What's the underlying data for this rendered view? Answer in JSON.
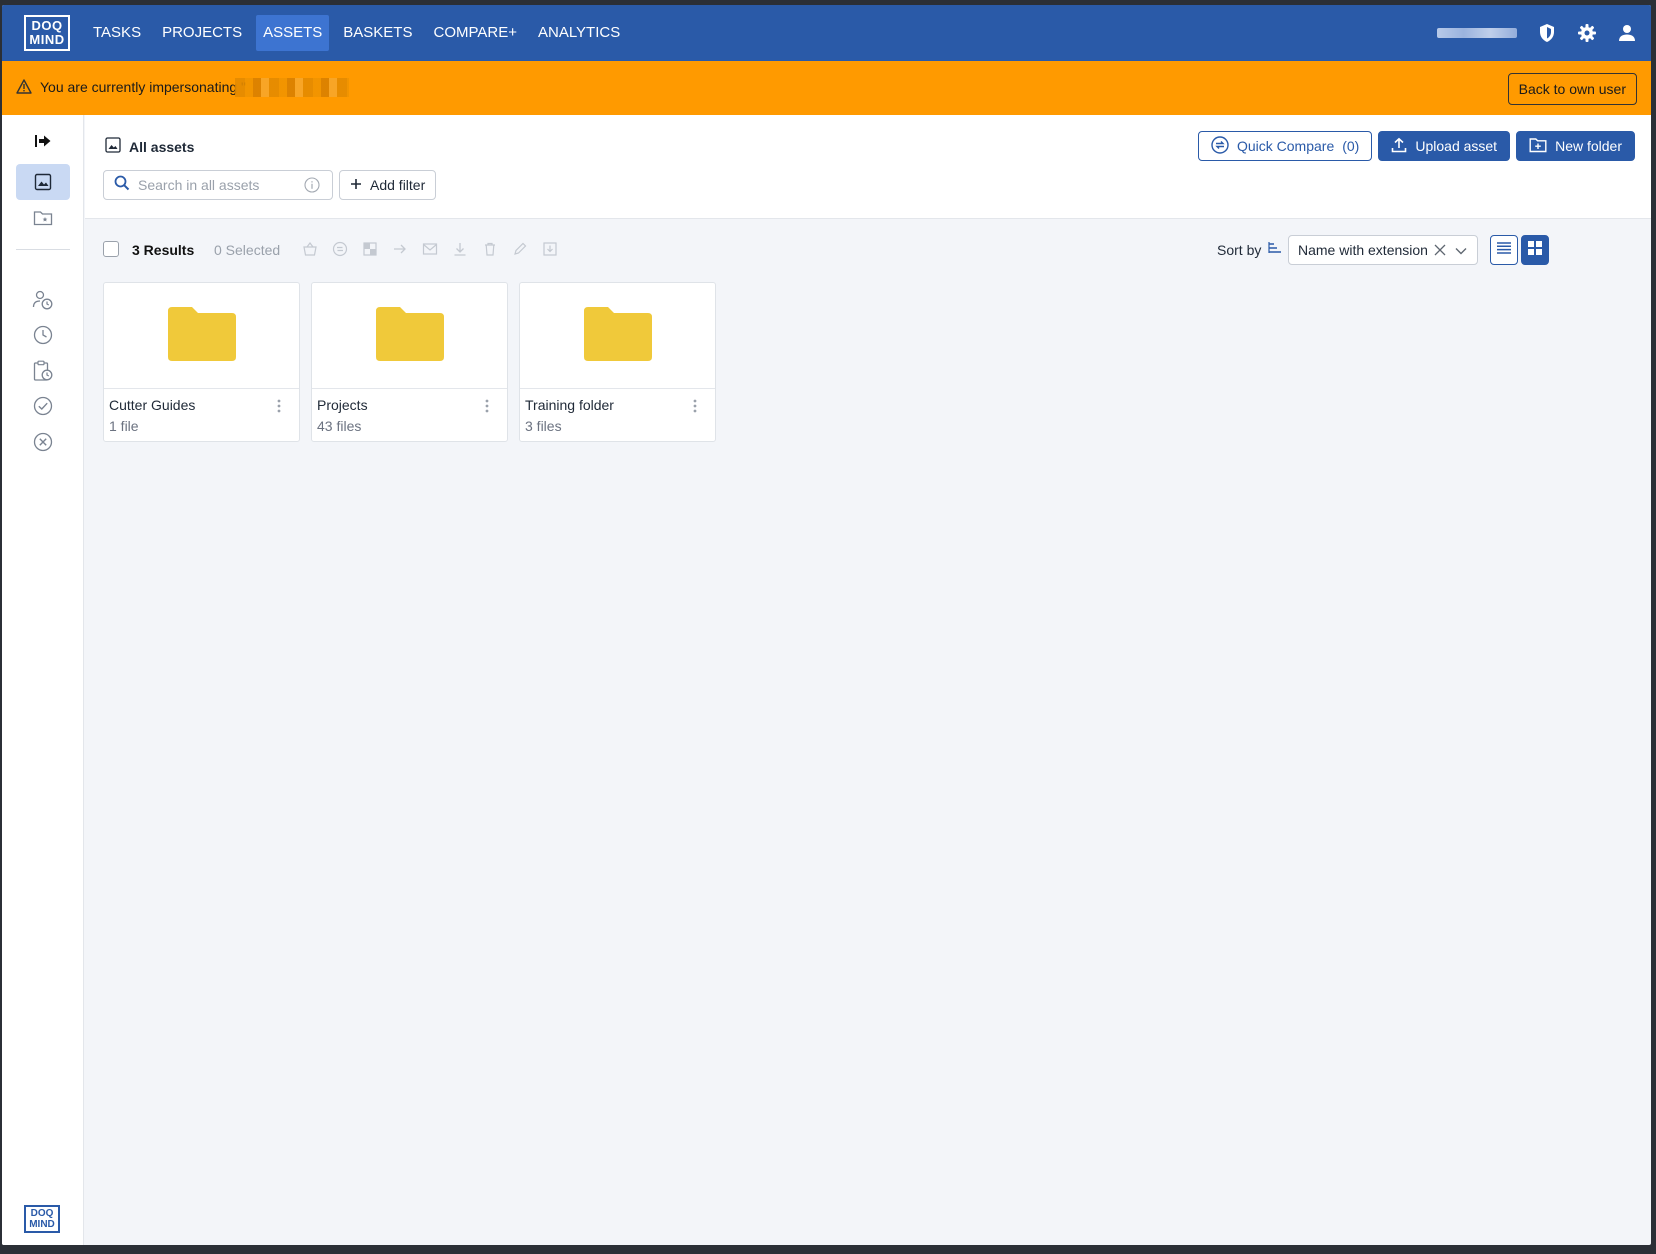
{
  "nav": {
    "logo": "DOQ MIND",
    "items": [
      {
        "label": "TASKS"
      },
      {
        "label": "PROJECTS"
      },
      {
        "label": "ASSETS"
      },
      {
        "label": "BASKETS"
      },
      {
        "label": "COMPARE+"
      },
      {
        "label": "ANALYTICS"
      }
    ],
    "active": "ASSETS"
  },
  "banner": {
    "text": "You are currently impersonating \"",
    "back_label": "Back to own user"
  },
  "header": {
    "title": "All assets",
    "search_placeholder": "Search in all assets",
    "add_filter_label": "Add filter",
    "quick_compare_label": "Quick Compare",
    "quick_compare_count": "(0)",
    "upload_label": "Upload asset",
    "new_folder_label": "New folder"
  },
  "toolbar": {
    "results": "3 Results",
    "selected": "0 Selected",
    "sort_label": "Sort by",
    "sort_value": "Name with extension"
  },
  "folders": [
    {
      "name": "Cutter Guides",
      "count": "1 file"
    },
    {
      "name": "Projects",
      "count": "43 files"
    },
    {
      "name": "Training folder",
      "count": "3 files"
    }
  ],
  "sidebar_logo": "DOQ MIND",
  "colors": {
    "primary": "#2a5aa8",
    "banner": "#ff9a00",
    "folder": "#f0c93a"
  }
}
